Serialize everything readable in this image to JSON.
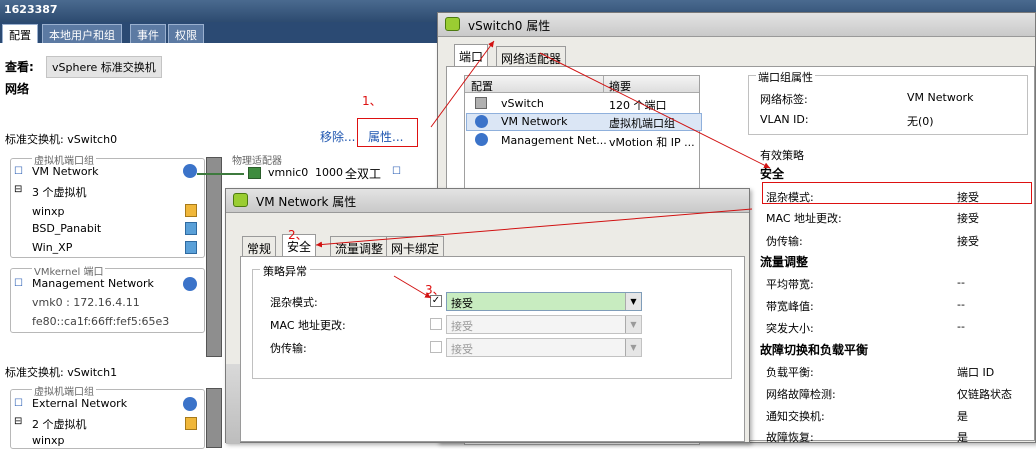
{
  "host": {
    "title": "1623387",
    "tabs": [
      "配置",
      "本地用户和组",
      "事件",
      "权限"
    ],
    "view_label": "查看:",
    "view_value": "vSphere 标准交换机",
    "network_label": "网络",
    "vswitch0_label": "标准交换机: vSwitch0",
    "move_link": "移除...",
    "props_link": "属性...",
    "vm_port_group_caption": "虚拟机端口组",
    "vm_network": "VM Network",
    "vm_count": "3 个虚拟机",
    "vms": [
      "winxp",
      "BSD_Panabit",
      "Win_XP"
    ],
    "phys_adapter_caption": "物理适配器",
    "vmnic": "vmnic0",
    "speed": "1000",
    "duplex": "全双工",
    "vmkernel_caption": "VMkernel 端口",
    "mgmt_network": "Management Network",
    "vmk_ip": "vmk0 : 172.16.4.11",
    "vmk_ipv6": "fe80::ca1f:66ff:fef5:65e3",
    "vswitch1_label": "标准交换机: vSwitch1",
    "vm_port_group_caption2": "虚拟机端口组",
    "external_network": "External Network",
    "vm_count2": "2 个虚拟机",
    "vm_partial": "winxp"
  },
  "vswitch_dialog": {
    "title": "vSwitch0 属性",
    "tabs": [
      "端口",
      "网络适配器"
    ],
    "col_config": "配置",
    "col_summary": "摘要",
    "rows": [
      {
        "name": "vSwitch",
        "summary": "120 个端口"
      },
      {
        "name": "VM Network",
        "summary": "虚拟机端口组"
      },
      {
        "name": "Management Net...",
        "summary": "vMotion 和 IP ..."
      }
    ],
    "portgroup_props_title": "端口组属性",
    "network_label_k": "网络标签:",
    "network_label_v": "VM Network",
    "vlan_k": "VLAN ID:",
    "vlan_v": "无(0)",
    "effective_policy_title": "有效策略",
    "security_title": "安全",
    "promisc_k": "混杂模式:",
    "promisc_v": "接受",
    "mac_k": "MAC 地址更改:",
    "mac_v": "接受",
    "forged_k": "伪传输:",
    "forged_v": "接受",
    "traffic_title": "流量调整",
    "avg_k": "平均带宽:",
    "avg_v": "--",
    "peak_k": "带宽峰值:",
    "peak_v": "--",
    "burst_k": "突发大小:",
    "burst_v": "--",
    "failover_title": "故障切换和负载平衡",
    "lb_k": "负载平衡:",
    "lb_v": "端口 ID",
    "detect_k": "网络故障检测:",
    "detect_v": "仅链路状态",
    "notify_k": "通知交换机:",
    "notify_v": "是",
    "failback_k": "故障恢复:",
    "failback_v": "是"
  },
  "vmnet_dialog": {
    "title": "VM Network 属性",
    "tabs": [
      "常规",
      "安全",
      "流量调整",
      "网卡绑定"
    ],
    "group_title": "策略异常",
    "promisc_label": "混杂模式:",
    "promisc_value": "接受",
    "promisc_checked": "✓",
    "mac_label": "MAC 地址更改:",
    "mac_value": "接受",
    "forged_label": "伪传输:",
    "forged_value": "接受"
  },
  "annotations": {
    "step1": "1、",
    "step2": "2、",
    "step3": "3、"
  },
  "colors": {
    "annotation_red": "#d11111",
    "host_header_blue": "#2b4a73",
    "selected_combo_green": "#c8ecc0"
  }
}
